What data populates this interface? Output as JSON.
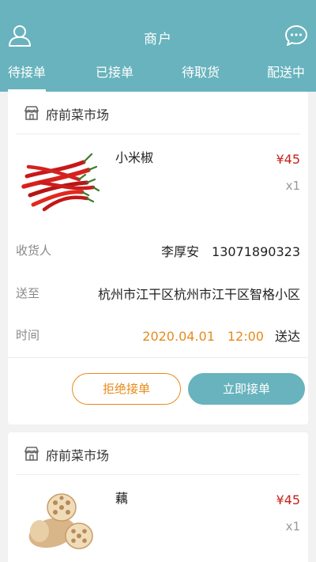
{
  "header": {
    "title": "商户",
    "tabs": [
      "待接单",
      "已接单",
      "待取货",
      "配送中"
    ],
    "active_tab": 0,
    "colors": {
      "primary": "#68b3bd",
      "price": "#c5231c",
      "accent": "#e88a1a"
    }
  },
  "orders": [
    {
      "shop_name": "府前菜市场",
      "product_name": "小米椒",
      "price": "¥45",
      "qty": "x1",
      "receiver_label": "收货人",
      "receiver_value": "李厚安　13071890323",
      "address_label": "送至",
      "address_value": "杭州市江干区杭州市江干区智格小区",
      "time_label": "时间",
      "time_value": "2020.04.01　12:00",
      "time_suffix": "送达",
      "reject_label": "拒绝接单",
      "accept_label": "立即接单"
    },
    {
      "shop_name": "府前菜市场",
      "product_name": "藕",
      "price": "¥45",
      "qty": "x1"
    }
  ]
}
